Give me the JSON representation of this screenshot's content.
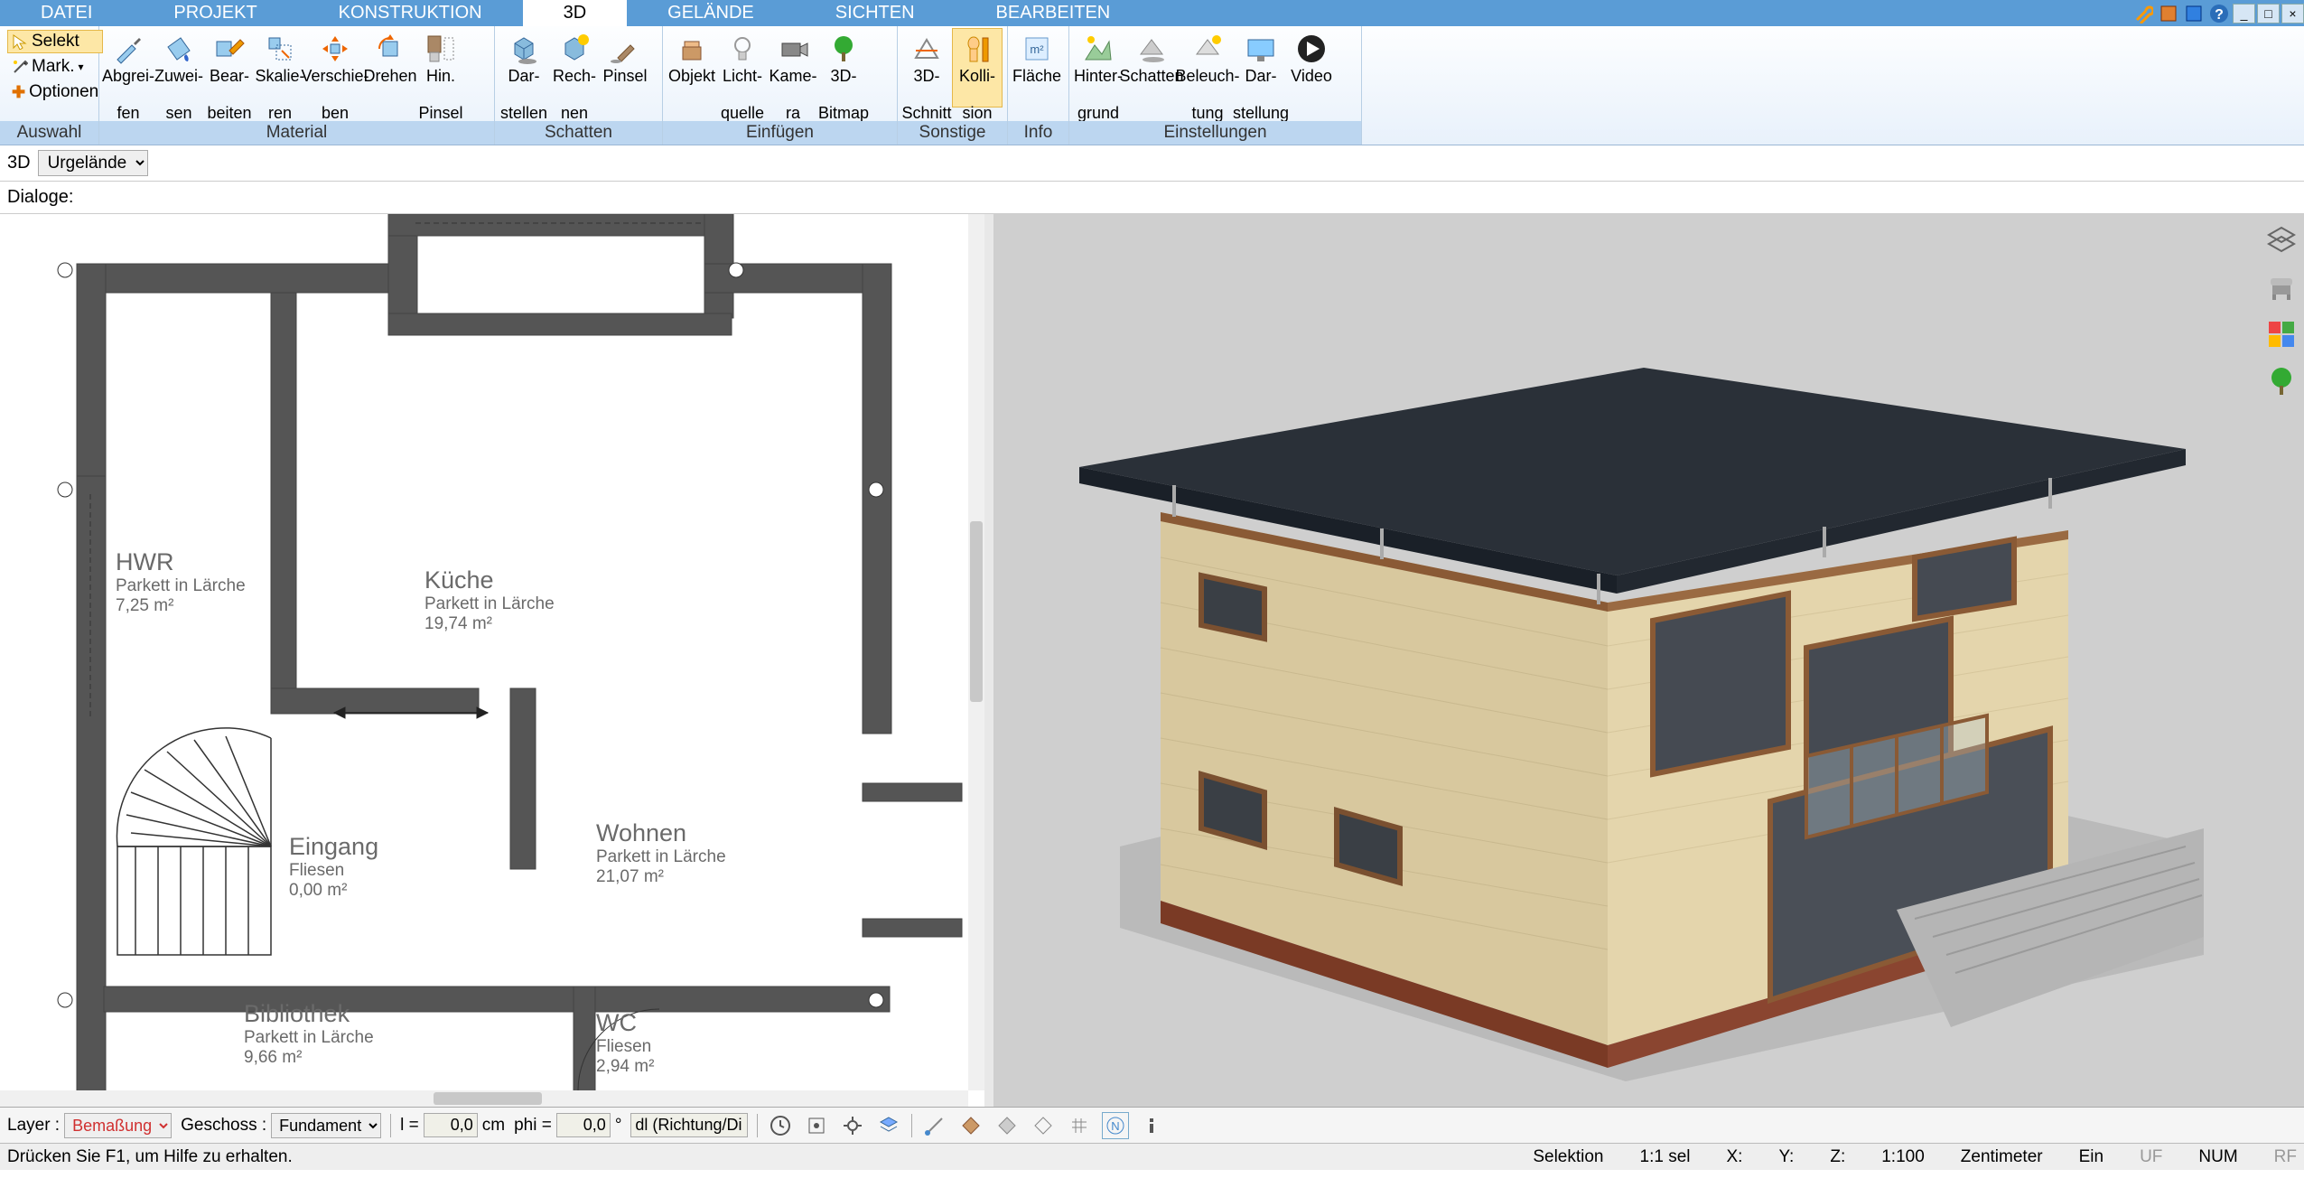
{
  "menu": {
    "items": [
      "DATEI",
      "PROJEKT",
      "KONSTRUKTION",
      "3D",
      "GELÄNDE",
      "SICHTEN",
      "BEARBEITEN"
    ],
    "active": 3
  },
  "ribbon": {
    "auswahl": {
      "label": "Auswahl",
      "selekt": "Selekt",
      "mark": "Mark.",
      "optionen": "Optionen"
    },
    "material": {
      "label": "Material",
      "abgreifen": "Abgrei-\nfen",
      "zuweisen": "Zuwei-\nsen",
      "bearbeiten": "Bear-\nbeiten",
      "skalieren": "Skalie-\nren",
      "verschieben": "Verschie-\nben",
      "drehen": "Drehen",
      "hinpinsel": "Hin.\nPinsel"
    },
    "schatten": {
      "label": "Schatten",
      "darstellen": "Dar-\nstellen",
      "rechnen": "Rech-\nnen",
      "pinsel": "Pinsel"
    },
    "einfuegen": {
      "label": "Einfügen",
      "objekt": "Objekt",
      "lichtquelle": "Licht-\nquelle",
      "kamera": "Kame-\nra",
      "bitmap": "3D-\nBitmap"
    },
    "sonstige": {
      "label": "Sonstige",
      "schnitt": "3D-\nSchnitt",
      "kollision": "Kolli-\nsion"
    },
    "info": {
      "label": "Info",
      "flaeche": "Fläche"
    },
    "einstellungen": {
      "label": "Einstellungen",
      "hintergrund": "Hinter-\ngrund",
      "schatten": "Schatten",
      "beleuchtung": "Beleuch-\ntung",
      "darstellung": "Dar-\nstellung",
      "video": "Video"
    }
  },
  "subbar": {
    "view": "3D",
    "dropdown": "Urgelände"
  },
  "dialoge": "Dialoge:",
  "rooms": {
    "hwr": {
      "name": "HWR",
      "mat": "Parkett in Lärche",
      "area": "7,25 m²"
    },
    "kueche": {
      "name": "Küche",
      "mat": "Parkett in Lärche",
      "area": "19,74 m²"
    },
    "eingang": {
      "name": "Eingang",
      "mat": "Fliesen",
      "area": "0,00 m²"
    },
    "wohnen": {
      "name": "Wohnen",
      "mat": "Parkett in Lärche",
      "area": "21,07 m²"
    },
    "bibliothek": {
      "name": "Bibliothek",
      "mat": "Parkett in Lärche",
      "area": "9,66 m²"
    },
    "wc": {
      "name": "WC",
      "mat": "Fliesen",
      "area": "2,94 m²"
    }
  },
  "bottom": {
    "layer_lbl": "Layer :",
    "layer_val": "Bemaßung",
    "geschoss_lbl": "Geschoss :",
    "geschoss_val": "Fundament",
    "l_lbl": "l =",
    "l_val": "0,0",
    "l_unit": "cm",
    "phi_lbl": "phi =",
    "phi_val": "0,0",
    "phi_unit": "°",
    "dl": "dl (Richtung/Di"
  },
  "status": {
    "hint": "Drücken Sie F1, um Hilfe zu erhalten.",
    "selektion": "Selektion",
    "sel": "1:1 sel",
    "x": "X:",
    "y": "Y:",
    "z": "Z:",
    "scale": "1:100",
    "unit": "Zentimeter",
    "ein": "Ein",
    "uf": "UF",
    "num": "NUM",
    "rf": "RF"
  }
}
